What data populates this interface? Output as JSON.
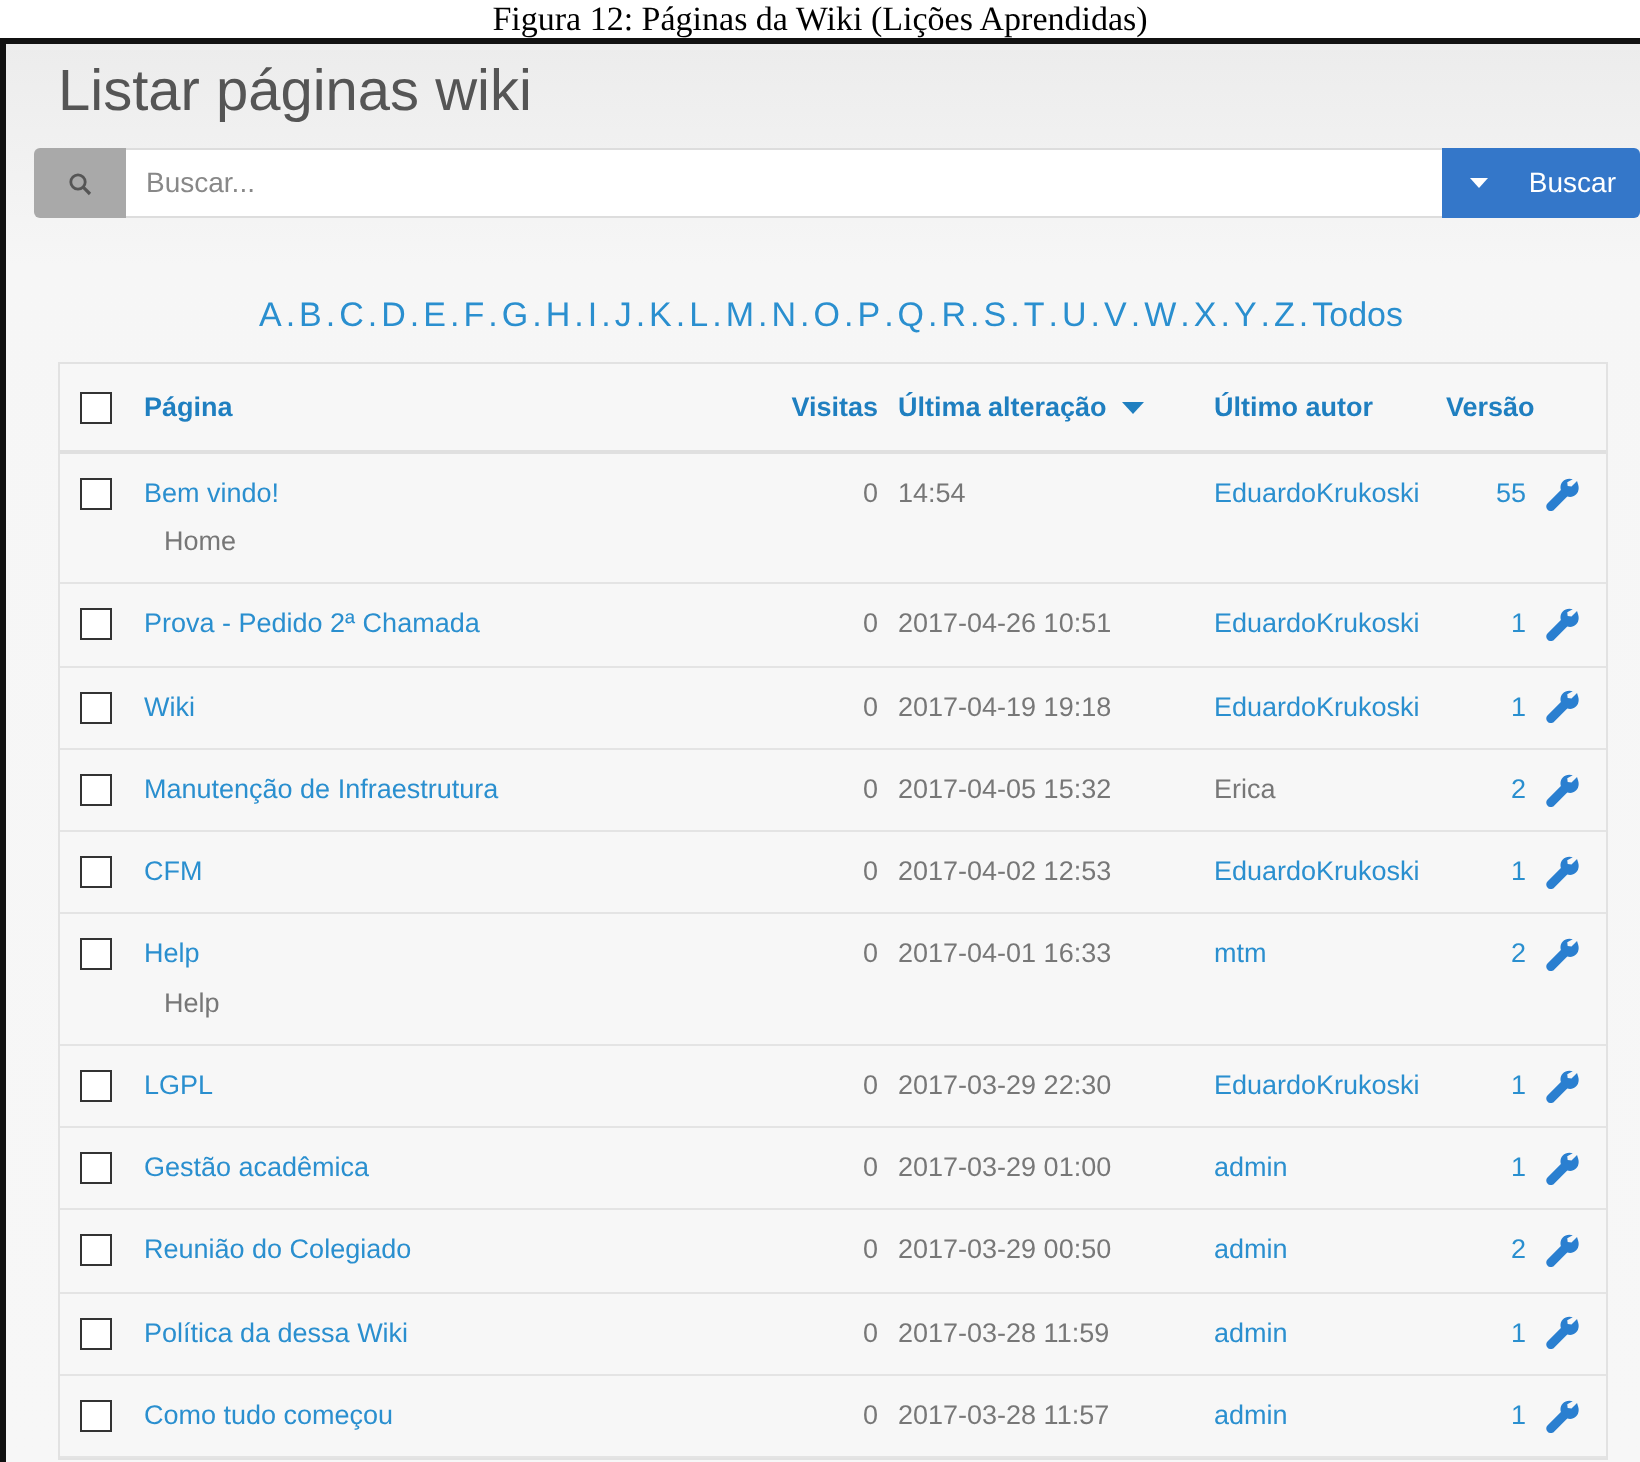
{
  "caption": "Figura 12: Páginas da Wiki (Lições Aprendidas)",
  "title": "Listar páginas wiki",
  "search": {
    "placeholder": "Buscar...",
    "button": "Buscar"
  },
  "letters": [
    "A",
    "B",
    "C",
    "D",
    "E",
    "F",
    "G",
    "H",
    "I",
    "J",
    "K",
    "L",
    "M",
    "N",
    "O",
    "P",
    "Q",
    "R",
    "S",
    "T",
    "U",
    "V",
    "W",
    "X",
    "Y",
    "Z"
  ],
  "separator": ".",
  "all_link": "Todos",
  "table": {
    "select_all": {
      "checked": false
    },
    "columns": [
      {
        "label": "Página",
        "sorted": false
      },
      {
        "label": "Visitas",
        "sorted": false
      },
      {
        "label": "Última alteração",
        "sorted": true
      },
      {
        "label": "Último autor",
        "sorted": false
      },
      {
        "label": "Versão",
        "sorted": false
      }
    ],
    "rows": [
      {
        "checked": false,
        "page": "Bem vindo!",
        "subtitle": "Home",
        "visits": "0",
        "modified": "14:54",
        "author": "EduardoKrukoski",
        "author_linked": true,
        "version": "55"
      },
      {
        "checked": false,
        "page": "Prova - Pedido 2ª Chamada",
        "visits": "0",
        "modified": "2017-04-26 10:51",
        "author": "EduardoKrukoski",
        "author_linked": true,
        "version": "1"
      },
      {
        "checked": false,
        "page": "Wiki",
        "visits": "0",
        "modified": "2017-04-19 19:18",
        "author": "EduardoKrukoski",
        "author_linked": true,
        "version": "1"
      },
      {
        "checked": false,
        "page": "Manutenção de Infraestrutura",
        "visits": "0",
        "modified": "2017-04-05 15:32",
        "author": "Erica",
        "author_linked": false,
        "version": "2"
      },
      {
        "checked": false,
        "page": "CFM",
        "visits": "0",
        "modified": "2017-04-02 12:53",
        "author": "EduardoKrukoski",
        "author_linked": true,
        "version": "1"
      },
      {
        "checked": false,
        "page": "Help",
        "subtitle": "Help",
        "visits": "0",
        "modified": "2017-04-01 16:33",
        "author": "mtm",
        "author_linked": true,
        "version": "2"
      },
      {
        "checked": false,
        "page": "LGPL",
        "visits": "0",
        "modified": "2017-03-29 22:30",
        "author": "EduardoKrukoski",
        "author_linked": true,
        "version": "1"
      },
      {
        "checked": false,
        "page": "Gestão acadêmica",
        "visits": "0",
        "modified": "2017-03-29 01:00",
        "author": "admin",
        "author_linked": true,
        "version": "1"
      },
      {
        "checked": false,
        "page": "Reunião do Colegiado",
        "visits": "0",
        "modified": "2017-03-29 00:50",
        "author": "admin",
        "author_linked": true,
        "version": "2"
      },
      {
        "checked": false,
        "page": "Política da dessa Wiki",
        "visits": "0",
        "modified": "2017-03-28 11:59",
        "author": "admin",
        "author_linked": true,
        "version": "1"
      },
      {
        "checked": false,
        "page": "Como tudo começou",
        "visits": "0",
        "modified": "2017-03-28 11:57",
        "author": "admin",
        "author_linked": true,
        "version": "1"
      }
    ]
  }
}
